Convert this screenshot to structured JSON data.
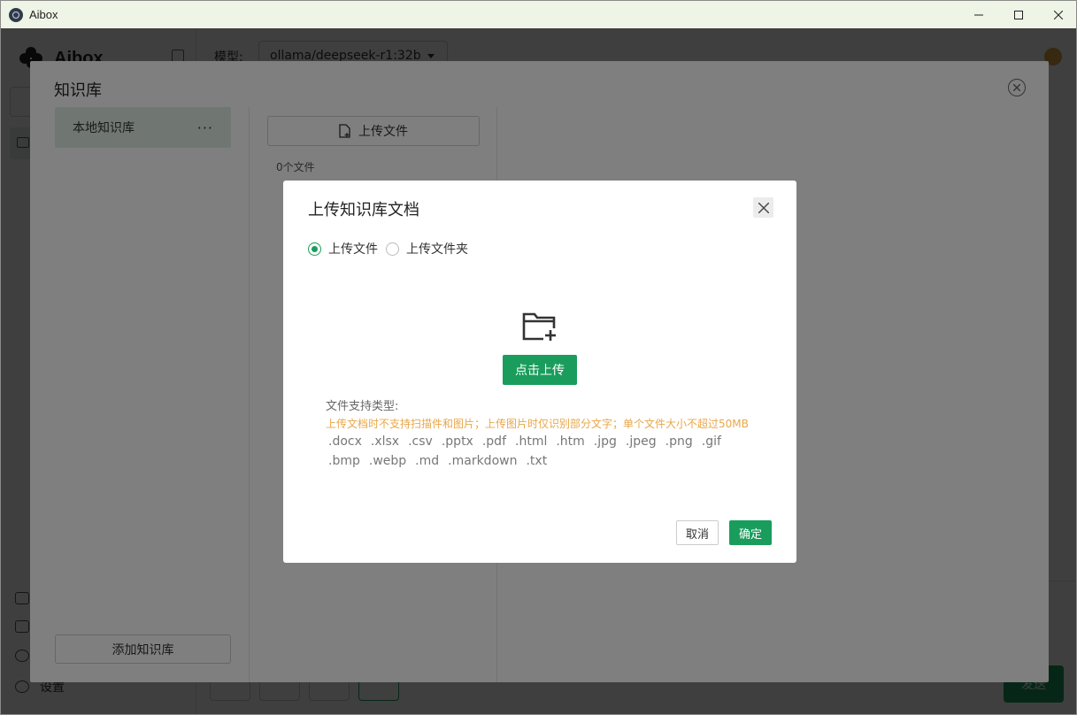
{
  "window": {
    "title": "Aibox"
  },
  "app": {
    "brand": "Aibox",
    "model_label": "模型:",
    "model_value": "ollama/deepseek-r1:32b",
    "settings_label": "设置",
    "send_label": "发送"
  },
  "kb_dialog": {
    "title": "知识库",
    "item_label": "本地知识库",
    "more": "···",
    "add_button": "添加知识库",
    "upload_button": "上传文件",
    "file_count": "0个文件"
  },
  "upload_modal": {
    "title": "上传知识库文档",
    "radio_file": "上传文件",
    "radio_folder": "上传文件夹",
    "click_upload": "点击上传",
    "support_label": "文件支持类型:",
    "warning": "上传文档时不支持扫描件和图片；上传图片时仅识别部分文字；单个文件大小不超过50MB",
    "file_types": [
      ".docx",
      ".xlsx",
      ".csv",
      ".pptx",
      ".pdf",
      ".html",
      ".htm",
      ".jpg",
      ".jpeg",
      ".png",
      ".gif",
      ".bmp",
      ".webp",
      ".md",
      ".markdown",
      ".txt"
    ],
    "cancel": "取消",
    "confirm": "确定"
  },
  "colors": {
    "accent": "#1a9d5c",
    "selected_bg": "#e1efe5",
    "warning": "#e8a74a",
    "titlebar_bg": "#eef4e6"
  }
}
